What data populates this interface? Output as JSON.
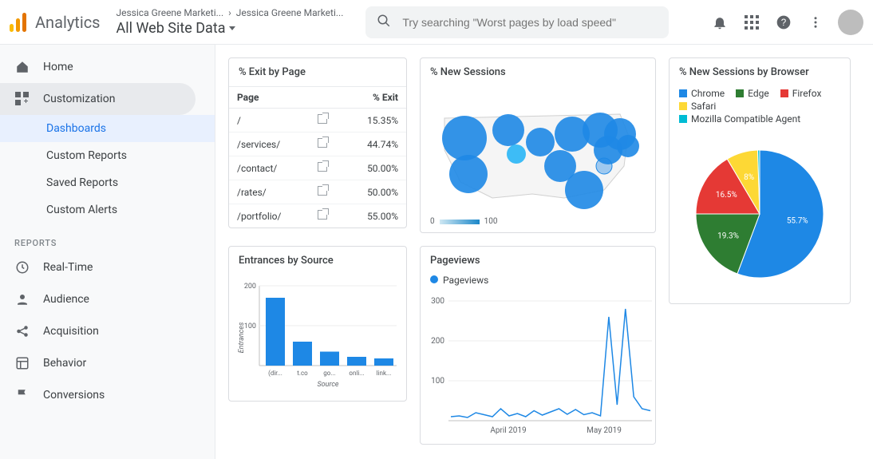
{
  "header": {
    "product": "Analytics",
    "breadcrumb_a": "Jessica Greene Marketi...",
    "breadcrumb_b": "Jessica Greene Marketi...",
    "view": "All Web Site Data",
    "search_placeholder": "Try searching \"Worst pages by load speed\""
  },
  "sidebar": {
    "home": "Home",
    "customization": "Customization",
    "sub": {
      "dashboards": "Dashboards",
      "custom_reports": "Custom Reports",
      "saved_reports": "Saved Reports",
      "custom_alerts": "Custom Alerts"
    },
    "reports_label": "REPORTS",
    "realtime": "Real-Time",
    "audience": "Audience",
    "acquisition": "Acquisition",
    "behavior": "Behavior",
    "conversions": "Conversions"
  },
  "cards": {
    "exit": {
      "title": "% Exit by Page",
      "col_page": "Page",
      "col_exit": "% Exit",
      "rows": [
        {
          "page": "/",
          "exit": "15.35%"
        },
        {
          "page": "/services/",
          "exit": "44.74%"
        },
        {
          "page": "/contact/",
          "exit": "50.00%"
        },
        {
          "page": "/rates/",
          "exit": "50.00%"
        },
        {
          "page": "/portfolio/",
          "exit": "55.00%"
        }
      ]
    },
    "map": {
      "title": "% New Sessions",
      "scale_min": "0",
      "scale_max": "100"
    },
    "pie": {
      "title": "% New Sessions by Browser",
      "legend": [
        "Chrome",
        "Edge",
        "Firefox",
        "Safari",
        "Mozilla Compatible Agent"
      ],
      "slices": [
        {
          "label": "55.7%",
          "value": 55.7,
          "color": "#1e88e5"
        },
        {
          "label": "19.3%",
          "value": 19.3,
          "color": "#2e7d32"
        },
        {
          "label": "16.5%",
          "value": 16.5,
          "color": "#e53935"
        },
        {
          "label": "8%",
          "value": 8.0,
          "color": "#fdd835"
        },
        {
          "label": "",
          "value": 0.5,
          "color": "#00bcd4"
        }
      ]
    },
    "entrances": {
      "title": "Entrances by Source",
      "ylabel": "Entrances",
      "xlabel": "Source",
      "ymax_label": "200",
      "ymid_label": "100"
    },
    "pageviews": {
      "title": "Pageviews",
      "series_label": "Pageviews",
      "y_300": "300",
      "y_200": "200",
      "y_100": "100",
      "x_apr": "April 2019",
      "x_may": "May 2019"
    }
  },
  "chart_data": [
    {
      "id": "exit_by_page",
      "type": "table",
      "columns": [
        "Page",
        "% Exit"
      ],
      "rows": [
        [
          "/",
          15.35
        ],
        [
          "/services/",
          44.74
        ],
        [
          "/contact/",
          50.0
        ],
        [
          "/rates/",
          50.0
        ],
        [
          "/portfolio/",
          55.0
        ]
      ]
    },
    {
      "id": "entrances_by_source",
      "type": "bar",
      "title": "Entrances by Source",
      "xlabel": "Source",
      "ylabel": "Entrances",
      "ylim": [
        0,
        200
      ],
      "categories": [
        "(dir...",
        "t.co",
        "go...",
        "onli...",
        "link..."
      ],
      "values": [
        170,
        60,
        35,
        22,
        18
      ]
    },
    {
      "id": "pageviews_timeseries",
      "type": "line",
      "title": "Pageviews",
      "ylabel": "Pageviews",
      "ylim": [
        0,
        300
      ],
      "x_ticks": [
        "April 2019",
        "May 2019"
      ],
      "series": [
        {
          "name": "Pageviews",
          "values": [
            10,
            12,
            8,
            20,
            15,
            10,
            30,
            12,
            18,
            10,
            25,
            14,
            22,
            30,
            16,
            28,
            15,
            20,
            12,
            260,
            40,
            280,
            60,
            30,
            25
          ]
        }
      ]
    },
    {
      "id": "new_sessions_by_browser",
      "type": "pie",
      "title": "% New Sessions by Browser",
      "slices": [
        {
          "name": "Chrome",
          "value": 55.7
        },
        {
          "name": "Edge",
          "value": 19.3
        },
        {
          "name": "Firefox",
          "value": 16.5
        },
        {
          "name": "Safari",
          "value": 8.0
        },
        {
          "name": "Mozilla Compatible Agent",
          "value": 0.5
        }
      ]
    },
    {
      "id": "new_sessions_map",
      "type": "heatmap",
      "title": "% New Sessions",
      "region": "United States",
      "scale": [
        0,
        100
      ],
      "note": "bubble map over US regions; exact per-region values not labeled"
    }
  ]
}
